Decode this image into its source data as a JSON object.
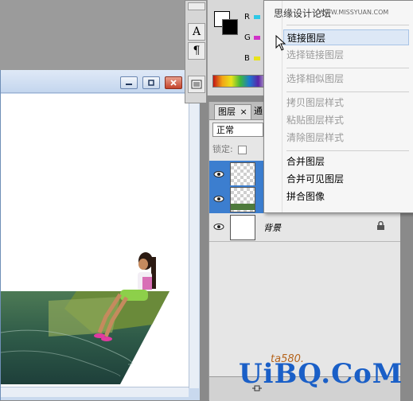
{
  "tools_panel": {
    "items": [
      {
        "icon": "text-tool-icon",
        "glyph": "A"
      },
      {
        "icon": "paragraph-icon",
        "glyph": "¶"
      },
      {
        "icon": "panel-menu-icon",
        "glyph": ""
      }
    ]
  },
  "color_panel": {
    "channels": [
      {
        "label": "R",
        "color": "#2ec8e6"
      },
      {
        "label": "G",
        "color": "#d032c8"
      },
      {
        "label": "B",
        "color": "#e8e21c"
      }
    ]
  },
  "layers_panel": {
    "tabs": [
      {
        "label": "图层"
      },
      {
        "label": "通"
      }
    ],
    "blend_mode": "正常",
    "lock_label": "锁定:",
    "layers": [
      {
        "name": "",
        "selected": true,
        "thumb": "checker"
      },
      {
        "name": "",
        "selected": true,
        "thumb": "checker-photo"
      },
      {
        "name": "背景",
        "selected": false,
        "thumb": "white"
      }
    ]
  },
  "context_menu": {
    "top_item": "思缘设计论坛",
    "items": [
      {
        "label": "链接图层",
        "state": "hover"
      },
      {
        "label": "选择链接图层",
        "state": "disabled"
      },
      {
        "label": "选择相似图层",
        "state": "disabled"
      },
      {
        "label": "拷贝图层样式",
        "state": "disabled"
      },
      {
        "label": "粘贴图层样式",
        "state": "disabled"
      },
      {
        "label": "清除图层样式",
        "state": "disabled"
      },
      {
        "label": "合并图层",
        "state": "enabled"
      },
      {
        "label": "合并可见图层",
        "state": "enabled"
      },
      {
        "label": "拼合图像",
        "state": "enabled"
      }
    ]
  },
  "watermarks": {
    "top": "WWW.MISSYUAN.COM",
    "bottom": "UiBQ.CoM",
    "bottom_small": "ta580."
  }
}
